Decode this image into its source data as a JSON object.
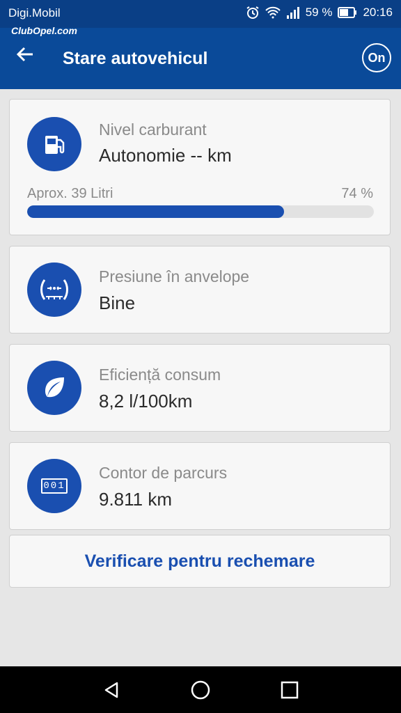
{
  "status_bar": {
    "carrier": "Digi.Mobil",
    "watermark": "ClubOpel.com",
    "battery": "59 %",
    "time": "20:16"
  },
  "app_bar": {
    "title": "Stare autovehicul",
    "logo_text": "On"
  },
  "fuel": {
    "label": "Nivel carburant",
    "value": "Autonomie -- km",
    "approx": "Aprox. 39 Litri",
    "percent_text": "74 %",
    "level": 0.74
  },
  "tires": {
    "label": "Presiune în anvelope",
    "value": "Bine"
  },
  "efficiency": {
    "label": "Eficiență consum",
    "value": "8,2 l/100km"
  },
  "odometer": {
    "label": "Contor de parcurs",
    "value": "9.811 km",
    "digits": "001"
  },
  "recall": {
    "label": "Verificare pentru rechemare"
  },
  "colors": {
    "accent": "#1a4fb0",
    "app_bar": "#0a4a99",
    "status_bar": "#0a3f86"
  }
}
